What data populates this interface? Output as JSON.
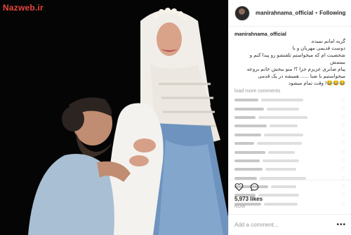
{
  "watermark": "Nazweb.ir",
  "post": {
    "username": "manirahnama_official",
    "separator": "•",
    "follow_label": "Following"
  },
  "caption": {
    "author": "manirahnama_official",
    "line1": "گربه امانم نمیده.",
    "line2": "دوست قدیمی مهربان و با",
    "line3": "شخصیت ام که میخواستم تلفنشو رو پیدا کنم و",
    "line4": "ببینمش",
    "line5": "پیام صابری عزیزم جرا ؟! منو ببخش خانم بروعه",
    "line6": "میخواستیم با صبا ...... همیشه در یک قدمی",
    "line7": "😂😂😂! وقت تمام میشود"
  },
  "load_more_label": "load more comments",
  "comment_count_visible": 13,
  "likes_label": "5,973 likes",
  "time_ago": "NOW",
  "add_comment_placeholder": "Add a comment...",
  "more_label": "•••",
  "icons": [
    "heart-icon",
    "comment-icon",
    "more-options-icon"
  ],
  "colors": {
    "watermark": "#e8453c",
    "veil": "#f1eee9",
    "dress": "#6e93bf",
    "background": "#050505"
  }
}
